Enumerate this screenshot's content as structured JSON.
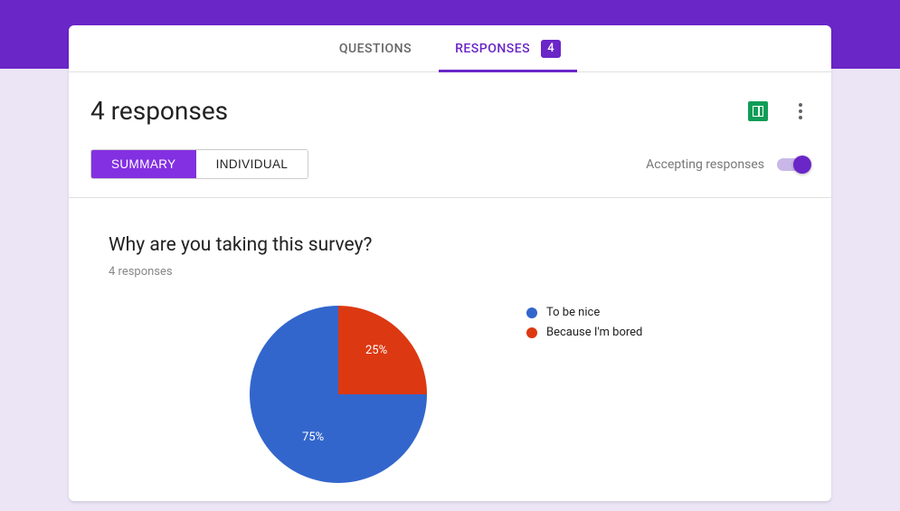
{
  "tabs": {
    "questions": "QUESTIONS",
    "responses": "RESPONSES",
    "badge": "4"
  },
  "header": {
    "title": "4 responses",
    "view_summary": "SUMMARY",
    "view_individual": "INDIVIDUAL",
    "accepting": "Accepting responses"
  },
  "question": {
    "title": "Why are you taking this survey?",
    "sub": "4 responses"
  },
  "chart_data": {
    "type": "pie",
    "title": "Why are you taking this survey?",
    "series": [
      {
        "name": "To be nice",
        "value": 75,
        "color": "#3366cc"
      },
      {
        "name": "Because I'm bored",
        "value": 25,
        "color": "#dc3912"
      }
    ],
    "labels": [
      "75%",
      "25%"
    ]
  }
}
